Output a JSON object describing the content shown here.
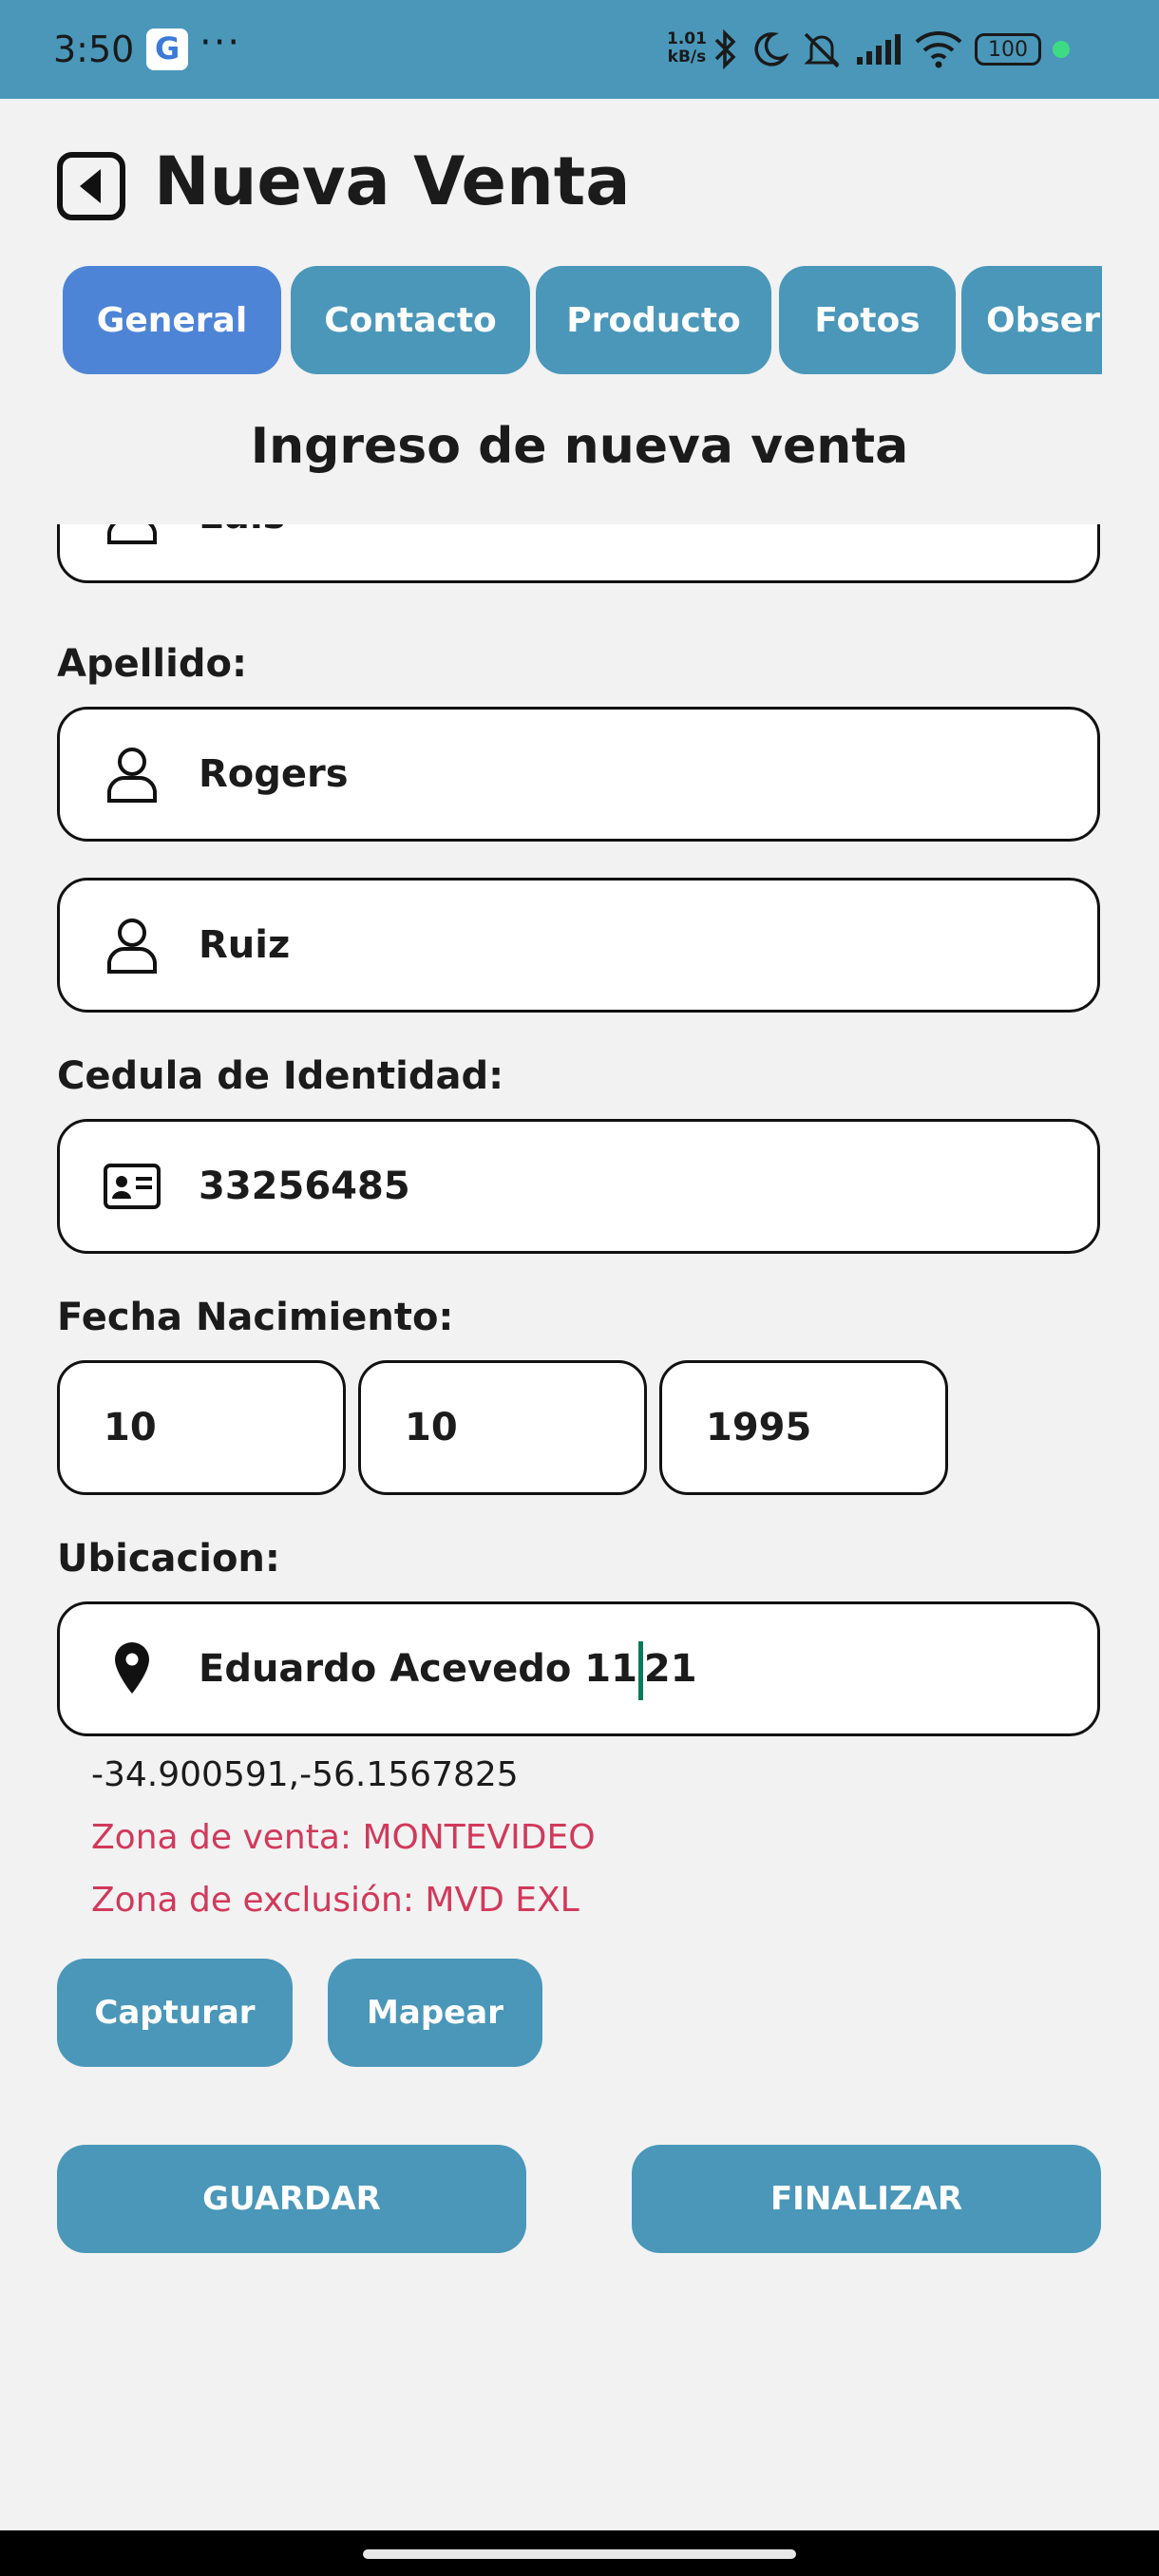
{
  "status_bar": {
    "time": "3:50",
    "google_icon": "G",
    "overflow": "···",
    "speed_value": "1.01",
    "speed_unit": "kB/s",
    "battery": "100",
    "icons": [
      "google-icon",
      "bluetooth-icon",
      "moon-icon",
      "mute-icon",
      "signal-icon",
      "wifi-icon",
      "battery-icon"
    ]
  },
  "header": {
    "title": "Nueva Venta"
  },
  "tabs": [
    {
      "label": "General",
      "active": true
    },
    {
      "label": "Contacto",
      "active": false
    },
    {
      "label": "Producto",
      "active": false
    },
    {
      "label": "Fotos",
      "active": false
    },
    {
      "label": "Obser",
      "active": false
    }
  ],
  "section_title": "Ingreso de nueva venta",
  "form": {
    "nombre_value": "Luis",
    "apellido_label": "Apellido:",
    "apellido1_value": "Rogers",
    "apellido2_value": "Ruiz",
    "cedula_label": "Cedula de Identidad:",
    "cedula_value": "33256485",
    "fecha_label": "Fecha Nacimiento:",
    "fecha_dia": "10",
    "fecha_mes": "10",
    "fecha_anio": "1995",
    "ubicacion_label": "Ubicacion:",
    "ubicacion_value_before": "Eduardo Acevedo 11",
    "ubicacion_value_after": "21",
    "coords": "-34.900591,-56.1567825",
    "zona_venta": "Zona de venta: MONTEVIDEO",
    "zona_exclusion": "Zona de exclusión: MVD EXL"
  },
  "buttons": {
    "capturar": "Capturar",
    "mapear": "Mapear",
    "guardar": "GUARDAR",
    "finalizar": "FINALIZAR"
  },
  "colors": {
    "accent": "#4a97b9",
    "active_tab": "#4d84d6",
    "warning_text": "#d1395a",
    "background": "#f2f2f2"
  }
}
